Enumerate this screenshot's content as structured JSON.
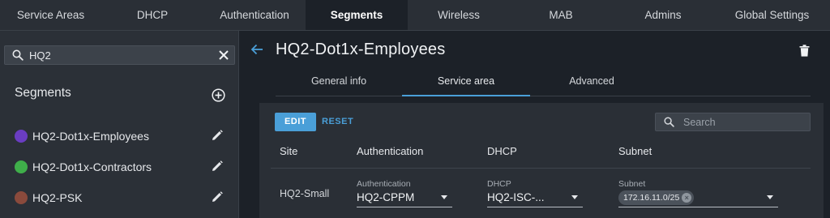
{
  "top_nav": {
    "tabs": [
      {
        "label": "Service Areas"
      },
      {
        "label": "DHCP"
      },
      {
        "label": "Authentication"
      },
      {
        "label": "Segments",
        "active": true
      },
      {
        "label": "Wireless"
      },
      {
        "label": "MAB"
      },
      {
        "label": "Admins"
      },
      {
        "label": "Global Settings"
      }
    ]
  },
  "sidebar": {
    "search": {
      "value": "HQ2"
    },
    "title": "Segments",
    "items": [
      {
        "label": "HQ2-Dot1x-Employees",
        "color": "#6a3dc2"
      },
      {
        "label": "HQ2-Dot1x-Contractors",
        "color": "#3fae4a"
      },
      {
        "label": "HQ2-PSK",
        "color": "#8a4a3c"
      }
    ]
  },
  "header": {
    "title": "HQ2-Dot1x-Employees"
  },
  "subtabs": [
    {
      "label": "General info"
    },
    {
      "label": "Service area",
      "active": true
    },
    {
      "label": "Advanced"
    }
  ],
  "panel": {
    "edit_label": "EDIT",
    "reset_label": "RESET",
    "search_placeholder": "Search",
    "columns": [
      "Site",
      "Authentication",
      "DHCP",
      "Subnet"
    ],
    "row": {
      "site": "HQ2-Small",
      "authentication": {
        "label": "Authentication",
        "value": "HQ2-CPPM"
      },
      "dhcp": {
        "label": "DHCP",
        "value": "HQ2-ISC-..."
      },
      "subnet": {
        "label": "Subnet",
        "chip": "172.16.11.0/25"
      }
    }
  },
  "colors": {
    "accent": "#4a9fd8",
    "background": "#1c2128",
    "panel": "#2a2f36"
  }
}
